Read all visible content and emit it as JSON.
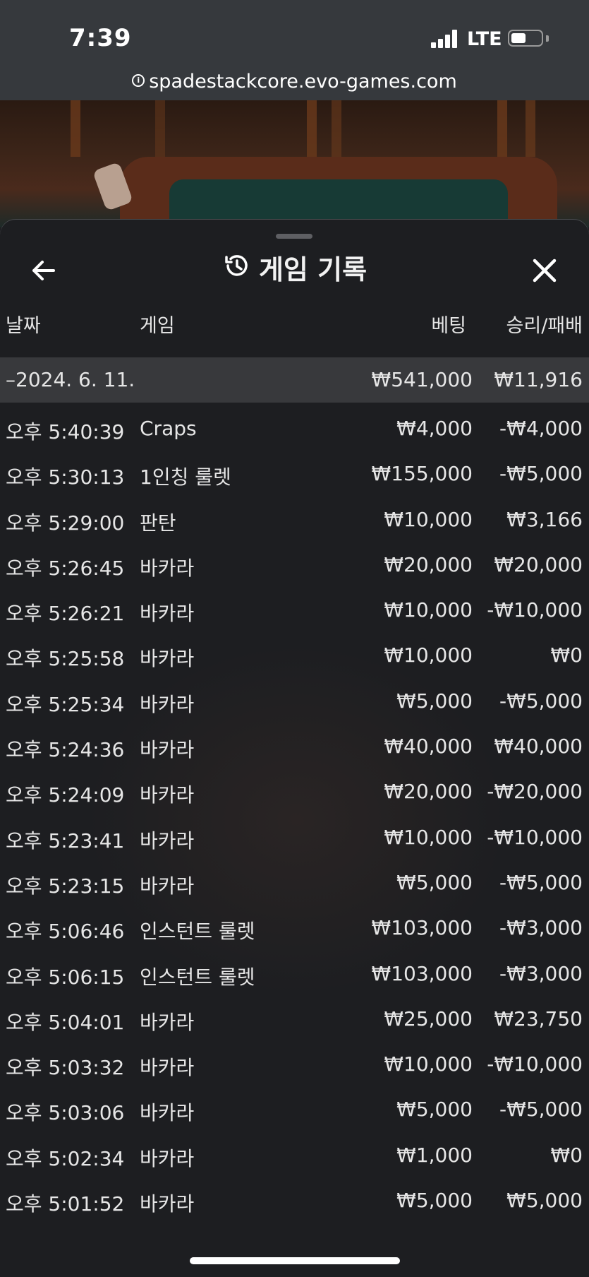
{
  "status": {
    "time": "7:39",
    "network": "LTE"
  },
  "browser": {
    "url": "spadestackcore.evo-games.com"
  },
  "panel": {
    "title": "게임 기록"
  },
  "columns": {
    "date": "날짜",
    "game": "게임",
    "bet": "베팅",
    "result": "승리/패배"
  },
  "date_group": {
    "date": "–2024. 6. 11.",
    "bet_total": "₩541,000",
    "result_total": "₩11,916"
  },
  "rows": [
    {
      "time": "오후 5:40:39",
      "game": "Craps",
      "bet": "₩4,000",
      "result": "-₩4,000"
    },
    {
      "time": "오후 5:30:13",
      "game": "1인칭 룰렛",
      "bet": "₩155,000",
      "result": "-₩5,000"
    },
    {
      "time": "오후 5:29:00",
      "game": "판탄",
      "bet": "₩10,000",
      "result": "₩3,166"
    },
    {
      "time": "오후 5:26:45",
      "game": "바카라",
      "bet": "₩20,000",
      "result": "₩20,000"
    },
    {
      "time": "오후 5:26:21",
      "game": "바카라",
      "bet": "₩10,000",
      "result": "-₩10,000"
    },
    {
      "time": "오후 5:25:58",
      "game": "바카라",
      "bet": "₩10,000",
      "result": "₩0"
    },
    {
      "time": "오후 5:25:34",
      "game": "바카라",
      "bet": "₩5,000",
      "result": "-₩5,000"
    },
    {
      "time": "오후 5:24:36",
      "game": "바카라",
      "bet": "₩40,000",
      "result": "₩40,000"
    },
    {
      "time": "오후 5:24:09",
      "game": "바카라",
      "bet": "₩20,000",
      "result": "-₩20,000"
    },
    {
      "time": "오후 5:23:41",
      "game": "바카라",
      "bet": "₩10,000",
      "result": "-₩10,000"
    },
    {
      "time": "오후 5:23:15",
      "game": "바카라",
      "bet": "₩5,000",
      "result": "-₩5,000"
    },
    {
      "time": "오후 5:06:46",
      "game": "인스턴트 룰렛",
      "bet": "₩103,000",
      "result": "-₩3,000"
    },
    {
      "time": "오후 5:06:15",
      "game": "인스턴트 룰렛",
      "bet": "₩103,000",
      "result": "-₩3,000"
    },
    {
      "time": "오후 5:04:01",
      "game": "바카라",
      "bet": "₩25,000",
      "result": "₩23,750"
    },
    {
      "time": "오후 5:03:32",
      "game": "바카라",
      "bet": "₩10,000",
      "result": "-₩10,000"
    },
    {
      "time": "오후 5:03:06",
      "game": "바카라",
      "bet": "₩5,000",
      "result": "-₩5,000"
    },
    {
      "time": "오후 5:02:34",
      "game": "바카라",
      "bet": "₩1,000",
      "result": "₩0"
    },
    {
      "time": "오후 5:01:52",
      "game": "바카라",
      "bet": "₩5,000",
      "result": "₩5,000"
    }
  ],
  "icons": {
    "back": "arrow-left-icon",
    "history": "history-icon",
    "close": "close-icon",
    "info": "info-icon"
  }
}
